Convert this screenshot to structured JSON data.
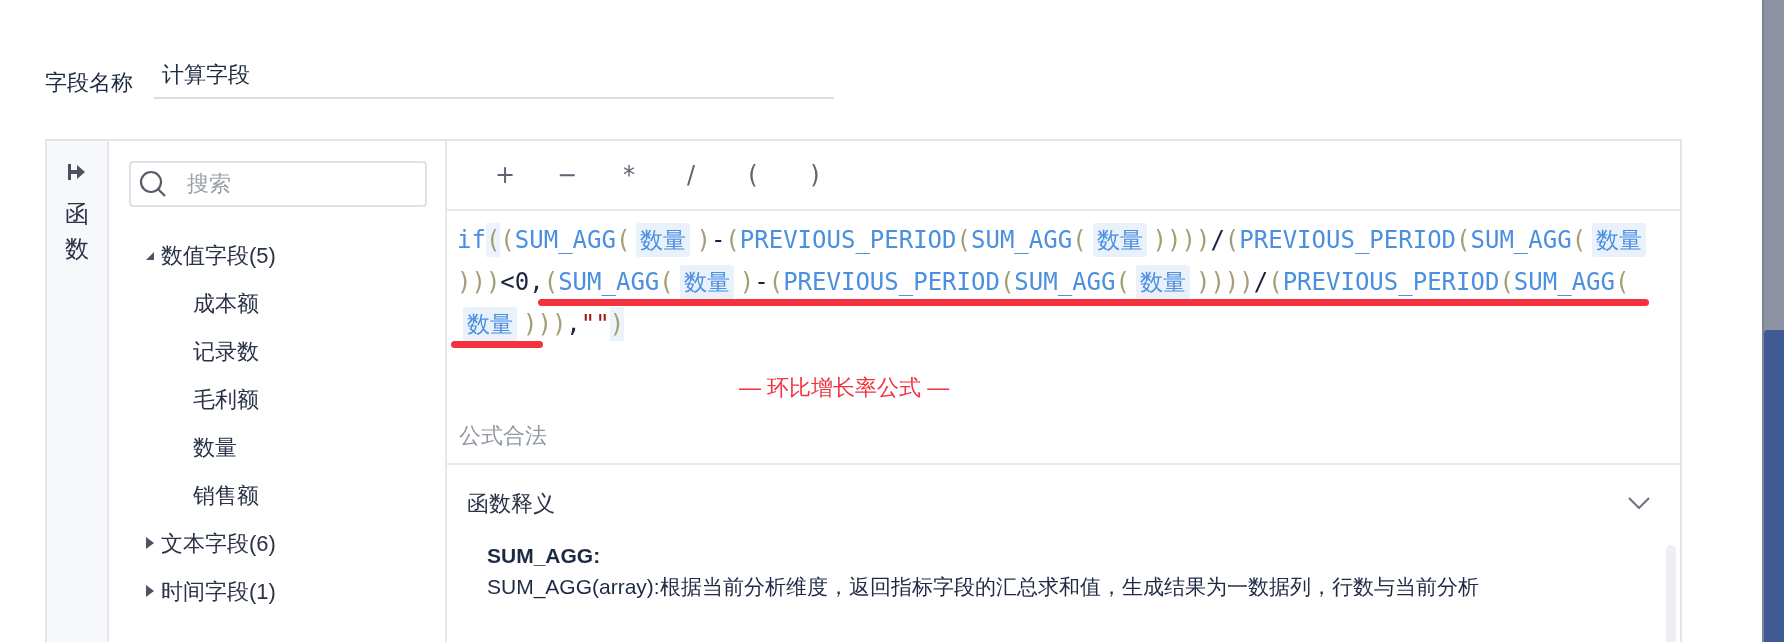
{
  "field_name": {
    "label": "字段名称",
    "value": "计算字段"
  },
  "sidebar": {
    "tab_label": "函数"
  },
  "search": {
    "placeholder": "搜索"
  },
  "tree": [
    {
      "label": "数值字段(5)",
      "expanded": true,
      "children": [
        {
          "label": "成本额"
        },
        {
          "label": "记录数"
        },
        {
          "label": "毛利额"
        },
        {
          "label": "数量"
        },
        {
          "label": "销售额"
        }
      ]
    },
    {
      "label": "文本字段(6)",
      "expanded": false
    },
    {
      "label": "时间字段(1)",
      "expanded": false
    }
  ],
  "operators": [
    "+",
    "−",
    "*",
    "/",
    "(",
    ")"
  ],
  "formula": {
    "lines": [
      {
        "segments": [
          {
            "underlined": false,
            "tokens": [
              {
                "kind": "keyword",
                "t": "if"
              },
              {
                "kind": "paren_match",
                "t": "("
              },
              {
                "kind": "paren",
                "t": "("
              },
              {
                "kind": "func",
                "t": "SUM_AGG"
              },
              {
                "kind": "paren",
                "t": "("
              },
              {
                "kind": "field",
                "t": "数量"
              },
              {
                "kind": "paren",
                "t": ")"
              },
              {
                "kind": "op",
                "t": "-"
              },
              {
                "kind": "paren",
                "t": "("
              },
              {
                "kind": "func",
                "t": "PREVIOUS_PERIOD"
              },
              {
                "kind": "paren",
                "t": "("
              },
              {
                "kind": "func",
                "t": "SUM_AGG"
              },
              {
                "kind": "paren",
                "t": "("
              },
              {
                "kind": "field",
                "t": "数量"
              },
              {
                "kind": "paren",
                "t": "))))"
              },
              {
                "kind": "op",
                "t": "/"
              },
              {
                "kind": "paren",
                "t": "("
              },
              {
                "kind": "func",
                "t": "PREVIOUS_PERIOD"
              },
              {
                "kind": "paren",
                "t": "("
              },
              {
                "kind": "func",
                "t": "SUM_AGG"
              },
              {
                "kind": "paren",
                "t": "("
              },
              {
                "kind": "field",
                "t": "数量"
              }
            ]
          }
        ]
      },
      {
        "segments": [
          {
            "underlined": false,
            "tokens": [
              {
                "kind": "paren",
                "t": ")))"
              },
              {
                "kind": "op",
                "t": "<0,"
              }
            ]
          },
          {
            "underlined": true,
            "tokens": [
              {
                "kind": "paren",
                "t": "("
              },
              {
                "kind": "func",
                "t": "SUM_AGG"
              },
              {
                "kind": "paren",
                "t": "("
              },
              {
                "kind": "field",
                "t": "数量"
              },
              {
                "kind": "paren",
                "t": ")"
              },
              {
                "kind": "op",
                "t": "-"
              },
              {
                "kind": "paren",
                "t": "("
              },
              {
                "kind": "func",
                "t": "PREVIOUS_PERIOD"
              },
              {
                "kind": "paren",
                "t": "("
              },
              {
                "kind": "func",
                "t": "SUM_AGG"
              },
              {
                "kind": "paren",
                "t": "("
              },
              {
                "kind": "field",
                "t": "数量"
              },
              {
                "kind": "paren",
                "t": "))))"
              },
              {
                "kind": "op",
                "t": "/"
              },
              {
                "kind": "paren",
                "t": "("
              },
              {
                "kind": "func",
                "t": "PREVIOUS_PERIOD"
              },
              {
                "kind": "paren",
                "t": "("
              },
              {
                "kind": "func",
                "t": "SUM_AGG"
              },
              {
                "kind": "paren",
                "t": "("
              }
            ]
          }
        ]
      },
      {
        "segments": [
          {
            "underlined": true,
            "tokens": [
              {
                "kind": "field",
                "t": "数量"
              }
            ]
          },
          {
            "underlined": false,
            "tokens": [
              {
                "kind": "paren",
                "t": ")))"
              },
              {
                "kind": "op",
                "t": ","
              },
              {
                "kind": "string",
                "t": "\"\""
              },
              {
                "kind": "paren_match",
                "t": ")"
              }
            ]
          }
        ]
      }
    ]
  },
  "annotation": "— 环比增长率公式 —",
  "validation": "公式合法",
  "function_help": {
    "title": "函数释义",
    "name": "SUM_AGG:",
    "description": "SUM_AGG(array):根据当前分析维度，返回指标字段的汇总求和值，生成结果为一数据列，行数与当前分析"
  }
}
